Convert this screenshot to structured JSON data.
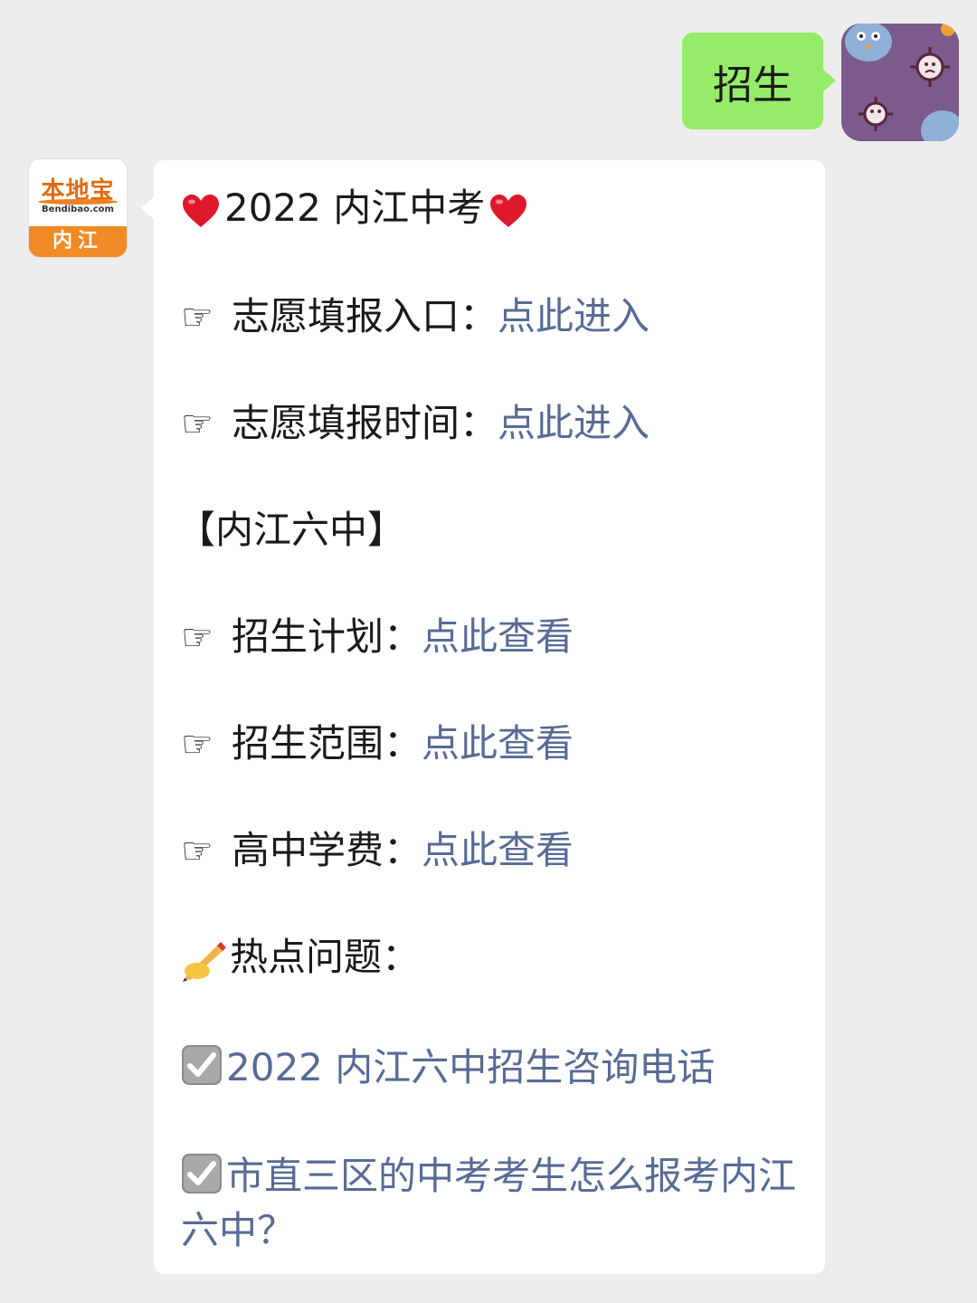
{
  "sent_message": {
    "text": "招生"
  },
  "bot": {
    "logo_text": "本地宝",
    "logo_sub": "Bendibao.com",
    "logo_city": "内江"
  },
  "reply": {
    "title": "2022 内江中考",
    "items_top": [
      {
        "label": "志愿填报入口：",
        "link": "点此进入"
      },
      {
        "label": "志愿填报时间：",
        "link": "点此进入"
      }
    ],
    "section_title": "【内江六中】",
    "items_school": [
      {
        "label": "招生计划：",
        "link": "点此查看"
      },
      {
        "label": "招生范围：",
        "link": "点此查看"
      },
      {
        "label": "高中学费：",
        "link": "点此查看"
      }
    ],
    "hot_label": "热点问题：",
    "hot_items": [
      "2022 内江六中招生咨询电话",
      "市直三区的中考考生怎么报考内江六中？"
    ]
  },
  "colors": {
    "sent_bubble": "#95ec69",
    "link": "#576b95",
    "background": "#ededed"
  },
  "icons": {
    "heart": "heart-icon",
    "hand": "pointing-hand-icon",
    "pen": "writing-hand-icon",
    "check": "check-box-icon"
  }
}
